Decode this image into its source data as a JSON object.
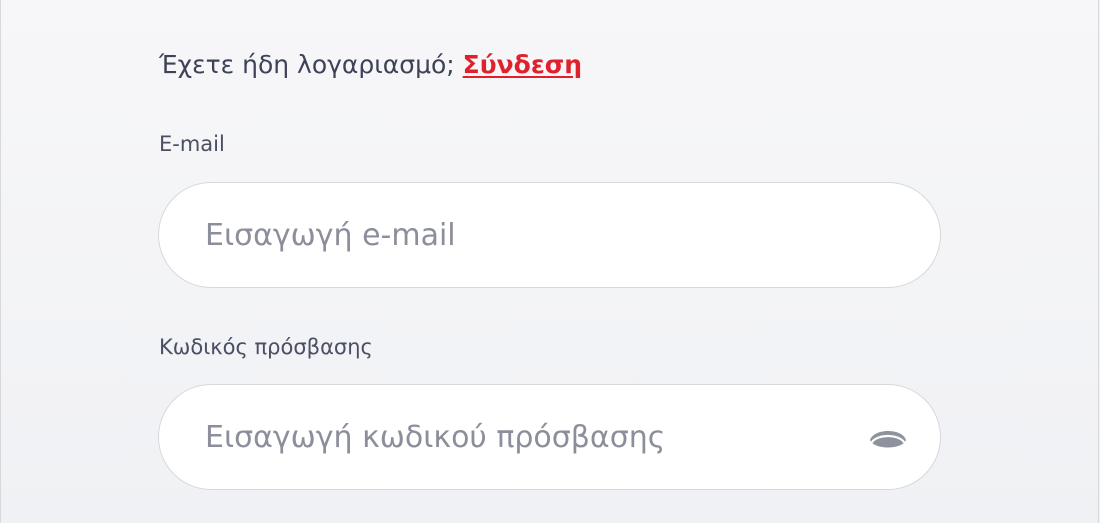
{
  "signin_prompt": {
    "text": "Έχετε ήδη λογαριασμό;",
    "link_label": "Σύνδεση"
  },
  "email": {
    "label": "E-mail",
    "placeholder": "Εισαγωγή e-mail",
    "value": ""
  },
  "password": {
    "label": "Κωδικός πρόσβασης",
    "placeholder": "Εισαγωγή κωδικού πρόσβασης",
    "value": "",
    "toggle_icon": "eye-icon"
  },
  "colors": {
    "link": "#e0202a",
    "text": "#3d4257",
    "placeholder": "#8c8f9b",
    "icon": "#8f929c"
  }
}
